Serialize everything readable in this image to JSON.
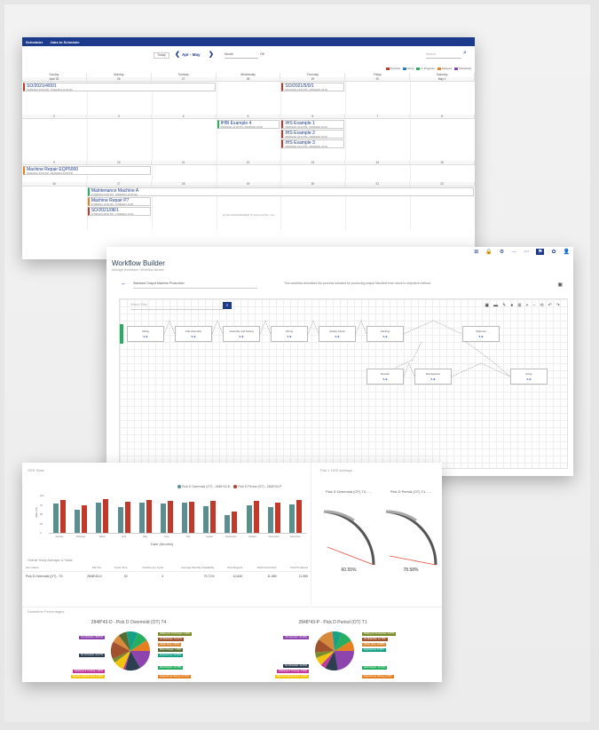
{
  "calendar": {
    "topbar": [
      "Scheduler",
      "Jobs to Schedule"
    ],
    "today": "Today",
    "prev": "❮",
    "next": "❯",
    "month": "Apr - May",
    "view": "Month",
    "lane": "Off",
    "search": "Search",
    "legend": [
      {
        "label": "Overdue",
        "color": "#c0392b"
      },
      {
        "label": "Done",
        "color": "#2980b9"
      },
      {
        "label": "In Progress",
        "color": "#27ae60"
      },
      {
        "label": "Delayed",
        "color": "#e67e22"
      },
      {
        "label": "Scheduled",
        "color": "#8e44ad"
      }
    ],
    "days": [
      "Sunday",
      "Monday",
      "Tuesday",
      "Wednesday",
      "Thursday",
      "Friday",
      "Saturday"
    ],
    "weeks": [
      {
        "nums": [
          "April 25",
          "26",
          "27",
          "28",
          "29",
          "30",
          "May 1"
        ],
        "events": [
          {
            "title": "SO/2021/4/001",
            "sub": "04/25/2021 03:00 PM - 07/26/2021 11:00 AM",
            "col": 0,
            "span": 3,
            "row": 0,
            "color": "#c0392b"
          },
          {
            "title": "SO/2021/5/0/1",
            "sub": "05/01/2021 03:00 PM - 05/03/2021 04:00",
            "col": 4,
            "span": 1,
            "row": 0,
            "color": "#c0392b"
          }
        ]
      },
      {
        "nums": [
          "2",
          "3",
          "4",
          "5",
          "6",
          "7",
          "8"
        ],
        "events": [
          {
            "title": "IHBI Example 4",
            "sub": "06/05/2021 03:00 PM - 06/05/2021 04:00",
            "col": 3,
            "span": 1,
            "row": 0,
            "color": "#27ae60"
          },
          {
            "title": "IHS Example 1",
            "sub": "06/05/2021 03:44 PM - 06/05/2021 04:00",
            "col": 4,
            "span": 1,
            "row": 0,
            "color": "#c0392b"
          },
          {
            "title": "IHS Example 2",
            "sub": "06/05/2021 03:44 PM - 06/05/2021 04:00",
            "col": 4,
            "span": 1,
            "row": 1,
            "color": "#c0392b"
          },
          {
            "title": "IHS Example 3",
            "sub": "06/05/2021 03:44 PM - 06/05/2021 04:00",
            "col": 4,
            "span": 1,
            "row": 2,
            "color": "#c0392b"
          }
        ]
      },
      {
        "nums": [
          "9",
          "10",
          "11",
          "12",
          "13",
          "14",
          "15"
        ],
        "events": [
          {
            "title": "Machine Repair EQP5000",
            "sub": "09/16/2021 03:00 PM - 09/16/2021 04:00 PM",
            "col": 0,
            "span": 2,
            "row": 0,
            "color": "#e67e22"
          }
        ]
      },
      {
        "nums": [
          "16",
          "17",
          "18",
          "19",
          "20",
          "21",
          "22"
        ],
        "events": [
          {
            "title": "Maintenance Machine A",
            "sub": "17/08/2021 03:00 PM - 18/08/2021 10:00 AM",
            "col": 1,
            "span": 6,
            "row": 0,
            "color": "#27ae60"
          },
          {
            "title": "Machine Repair P7",
            "sub": "17/08/2021 10:00 AM - 17/08/2021 10:00",
            "col": 1,
            "span": 1,
            "row": 1,
            "color": "#e67e22"
          },
          {
            "title": "SO/2021/08/1",
            "sub": "17/08/2021 08:00 PM - 17/08/2021 10:00",
            "col": 1,
            "span": 1,
            "row": 2,
            "color": "#c0392b"
          }
        ]
      }
    ],
    "footer": "(c) E2i MANAGEMENT & Ventures Pte. Ltd."
  },
  "workflow": {
    "title": "Workflow Builder",
    "breadcrumb": "Manage Workflows / Workflow Builder",
    "name": "Standard Output Machine Production",
    "description": "This workflow describes the process followed for producing output Machine from stock to shipment method.",
    "search_placeholder": "Search Step",
    "nodes": [
      {
        "label": "Kitting",
        "row": 0,
        "col": 0
      },
      {
        "label": "Sub-Assembly",
        "row": 0,
        "col": 1
      },
      {
        "label": "Assembly and Testing",
        "row": 0,
        "col": 2
      },
      {
        "label": "Wiring",
        "row": 0,
        "col": 3
      },
      {
        "label": "Quality Check",
        "row": 0,
        "col": 4
      },
      {
        "label": "Packing",
        "row": 0,
        "col": 5
      },
      {
        "label": "Shipment",
        "row": 0,
        "col": 7
      },
      {
        "label": "Rework",
        "row": 1,
        "col": 5
      },
      {
        "label": "Reinspection",
        "row": 1,
        "col": 6
      },
      {
        "label": "Scrap",
        "row": 1,
        "col": 8
      }
    ],
    "top_icons": [
      "⊞",
      "🔒",
      "⚙",
      "…",
      "⋯",
      "⚑",
      "✿",
      "👤"
    ],
    "tools": [
      "▣",
      "▬",
      "✎",
      "●",
      "⊞",
      "+",
      "−",
      "⟲",
      "↶",
      "↷"
    ]
  },
  "dashboard": {
    "oee_title": "OEE Stats",
    "legend": [
      {
        "label": "Pick D Overmold (OT) - 2848*43-D",
        "color": "#5b8f8f"
      },
      {
        "label": "Pick D Period (OT) - 2848*43-P",
        "color": "#c0392b"
      }
    ],
    "chart_data": {
      "type": "bar",
      "categories": [
        "January",
        "February",
        "March",
        "April",
        "May",
        "June",
        "July",
        "August",
        "September",
        "October",
        "November",
        "December"
      ],
      "series": [
        {
          "name": "Pick D Overmold (OT) - 2848*43-D",
          "values": [
            78,
            62,
            80,
            70,
            82,
            78,
            80,
            72,
            48,
            75,
            68,
            76
          ]
        },
        {
          "name": "Pick D Period (OT) - 2848*43-P",
          "values": [
            88,
            74,
            90,
            84,
            88,
            86,
            84,
            86,
            58,
            86,
            82,
            88
          ]
        }
      ],
      "xlabel": "Date (Months)",
      "ylabel": "OEE (%)",
      "ylim": [
        0,
        100
      ]
    },
    "yticks": [
      "100",
      "75",
      "50",
      "25",
      "0"
    ],
    "table_caption": "Overall Yearly Averages & Totals",
    "table_headers": [
      "Item Name",
      "Part No.",
      "Cycle Time",
      "Cavities per Cycle",
      "Average Monthly Availability",
      "Total Rejects",
      "Total Good Parts",
      "Total Produced"
    ],
    "table_row": [
      "Pick D Overmold (OT) - T4",
      "2848*43-D",
      "92",
      "4",
      "79.71%",
      "10.640",
      "11.089",
      "11.089"
    ],
    "gauge_title": "Part 1 OEE Average",
    "gauges": [
      {
        "title": "Pick D Overmold (OT) T4 - ...",
        "value": "60.55%"
      },
      {
        "title": "Pick D Period (OT) T1 - ...",
        "value": "78.58%"
      }
    ],
    "pies_caption": "Downtime Percentages",
    "pies": [
      {
        "title": "2848*43-D - Pick D Overmold (OT) T4",
        "labels": [
          {
            "t": "No Operator: 18.87%",
            "c": "#8e44ad",
            "side": "l",
            "y": 8
          },
          {
            "t": "No Schedule: 14.47%",
            "c": "#2c3e50",
            "side": "l",
            "y": 28
          },
          {
            "t": "Meetings & Training: 1.89%",
            "c": "#c0399b",
            "side": "l",
            "y": 46
          },
          {
            "t": "Machine Maintenance: 9.88%",
            "c": "#f1c40f",
            "side": "l",
            "y": 52
          },
          {
            "t": "Waiting for Technician: 4.00%",
            "c": "#7a8b2c",
            "side": "r",
            "y": 4
          },
          {
            "t": "No Materials: 16.17%",
            "c": "#a0522d",
            "side": "r",
            "y": 10
          },
          {
            "t": "Setup Time: 7.83%",
            "c": "#d68a3a",
            "side": "r",
            "y": 16
          },
          {
            "t": "Mold Change: 7.92%",
            "c": "#556b2f",
            "side": "r",
            "y": 22
          },
          {
            "t": "Engineering: 10.66%",
            "c": "#16a085",
            "side": "r",
            "y": 28
          },
          {
            "t": "Mold Repair: 10.78%",
            "c": "#27ae60",
            "side": "r",
            "y": 42
          },
          {
            "t": "Engineering Testing: 10.52%",
            "c": "#e67e22",
            "side": "r",
            "y": 52
          }
        ]
      },
      {
        "title": "2848*43-P - Pick D Period (OT) T1",
        "labels": [
          {
            "t": "No Operator: 23.48%",
            "c": "#8e44ad",
            "side": "l",
            "y": 8
          },
          {
            "t": "No Schedule: 11.32%",
            "c": "#2c3e50",
            "side": "l",
            "y": 40
          },
          {
            "t": "Meetings & Training: 4.59%",
            "c": "#c0399b",
            "side": "l",
            "y": 46
          },
          {
            "t": "Machine Maintenance: 7.33%",
            "c": "#f1c40f",
            "side": "l",
            "y": 52
          },
          {
            "t": "Waiting for Technician: 4.97%",
            "c": "#7a8b2c",
            "side": "r",
            "y": 4
          },
          {
            "t": "No Materials: 11.75%",
            "c": "#a0522d",
            "side": "r",
            "y": 10
          },
          {
            "t": "Setup Time: 13.89%",
            "c": "#d68a3a",
            "side": "r",
            "y": 16
          },
          {
            "t": "Engineering: 8.24%",
            "c": "#16a085",
            "side": "r",
            "y": 22
          },
          {
            "t": "Mold Repair: 10.72%",
            "c": "#27ae60",
            "side": "r",
            "y": 42
          },
          {
            "t": "Engineering Testing: 9.33%",
            "c": "#e67e22",
            "side": "r",
            "y": 52
          }
        ]
      }
    ]
  }
}
